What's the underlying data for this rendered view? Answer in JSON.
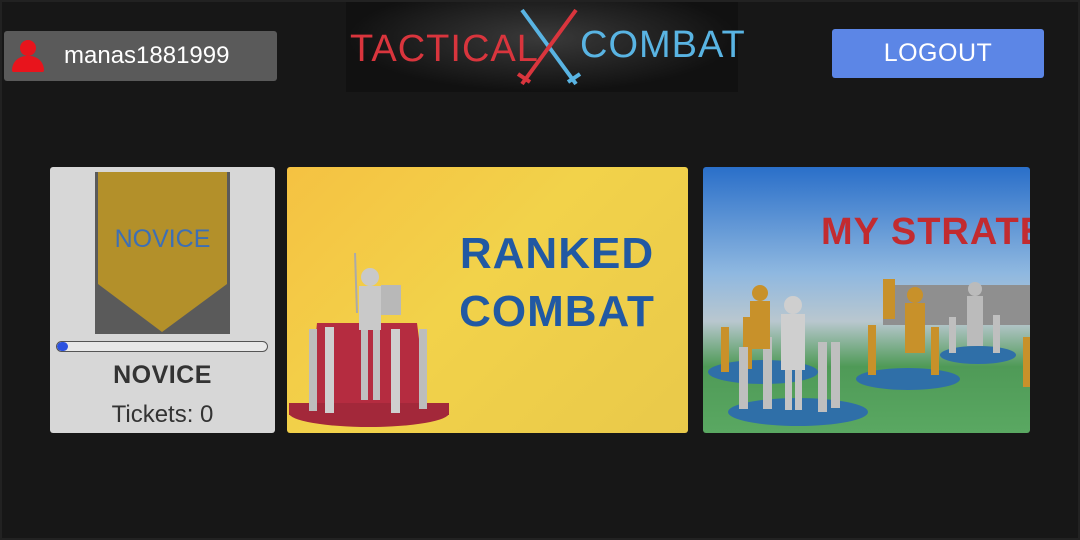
{
  "header": {
    "username": "manas1881999",
    "logo": {
      "word_left": "TACTICAL",
      "word_right": "COMBAT"
    },
    "logout_label": "LOGOUT"
  },
  "rank": {
    "badge_text": "NOVICE",
    "progress": 0.02,
    "name": "NOVICE",
    "tickets_label": "Tickets: 0"
  },
  "modes": [
    {
      "title_line1": "RANKED",
      "title_line2": "COMBAT"
    },
    {
      "title": "MY STRATE"
    }
  ],
  "colors": {
    "avatar": "#e8141c",
    "logout": "#5c86e6",
    "logo_red": "#d9353d",
    "logo_blue": "#59b4e3",
    "ranked_text": "#2159a3",
    "strategy_text": "#c22b30",
    "badge_gold": "#b3902a"
  }
}
